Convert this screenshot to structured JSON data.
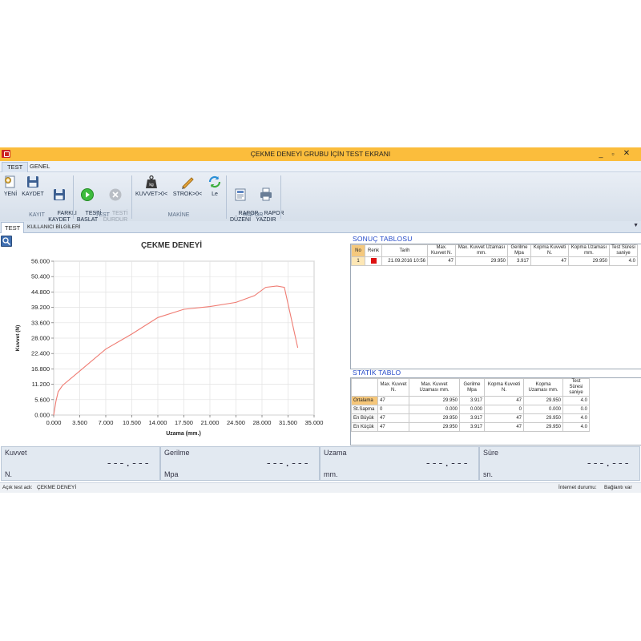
{
  "window": {
    "title": "ÇEKME DENEYİ GRUBU İÇİN TEST EKRANI",
    "controls": [
      "_",
      "▫",
      "✕"
    ]
  },
  "ribbon_tabs": [
    "TEST",
    "GENEL"
  ],
  "ribbon": {
    "groups": [
      {
        "label": "KAYIT",
        "buttons": [
          "YENİ",
          "KAYDET",
          "FARKLI\nKAYDET"
        ]
      },
      {
        "label": "TEST",
        "buttons": [
          "TESTİ\nBAŞLAT",
          "TESTİ\nDURDUR"
        ]
      },
      {
        "label": "MAKİNE",
        "buttons": [
          "KUVVET>0<",
          "STROK>0<",
          "Le"
        ]
      },
      {
        "label": "RAPOR",
        "buttons": [
          "RAPOR\nDÜZENİ",
          "RAPOR\nYAZDIR"
        ]
      }
    ],
    "icon_names": [
      "new-document-icon",
      "save-icon",
      "save-as-icon",
      "play-icon",
      "stop-icon",
      "weight-icon",
      "pencil-ruler-icon",
      "refresh-icon",
      "report-layout-icon",
      "printer-icon"
    ]
  },
  "subtabs": [
    "TEST",
    "KULLANICI BİLGİLERİ"
  ],
  "chart_data": {
    "type": "line",
    "title": "ÇEKME DENEYİ",
    "xlabel": "Uzama (mm.)",
    "ylabel": "Kuvvet (N)",
    "xlim": [
      0,
      35
    ],
    "ylim": [
      0,
      56
    ],
    "x_ticks": [
      "0.000",
      "3.500",
      "7.000",
      "10.500",
      "14.000",
      "17.500",
      "21.000",
      "24.500",
      "28.000",
      "31.500",
      "35.000"
    ],
    "y_ticks": [
      "0.000",
      "5.600",
      "11.200",
      "16.800",
      "22.400",
      "28.000",
      "33.600",
      "39.200",
      "44.800",
      "50.400",
      "56.000"
    ],
    "grid": true,
    "color": "#ef7b72",
    "series": [
      {
        "x": [
          0,
          0.3,
          0.6,
          1.2,
          3.5,
          7.0,
          10.5,
          14.0,
          17.5,
          21.0,
          24.5,
          27.0,
          28.5,
          30.0,
          31.0,
          32.8
        ],
        "y": [
          0,
          5.0,
          8.5,
          10.8,
          16.0,
          24.0,
          29.5,
          35.5,
          38.5,
          39.5,
          41.0,
          43.5,
          46.5,
          47.0,
          46.5,
          24.5
        ]
      }
    ]
  },
  "result_table": {
    "title": "SONUÇ TABLOSU",
    "headers": [
      "No",
      "Renk",
      "Tarih",
      "Max. Kuvvet N.",
      "Max. Kuvvet Uzaması mm.",
      "Gerilme Mpa",
      "Kopma Kuvveti N.",
      "Kopma Uzaması mm.",
      "Test Süresi saniye"
    ],
    "rows": [
      {
        "no": "1",
        "color": "#dd1111",
        "tarih": "21.09.2016 10:56",
        "max_kuvvet": "47",
        "max_uzama": "29.950",
        "gerilme": "3.917",
        "kopma_kuvvet": "47",
        "kopma_uzama": "29.950",
        "sure": "4.0"
      }
    ]
  },
  "stat_table": {
    "title": "STATİK TABLO",
    "headers": [
      "",
      "Max. Kuvvet N.",
      "Max. Kuvvet Uzaması mm.",
      "Gerilme Mpa",
      "Kopma Kuvveti N.",
      "Kopma Uzaması mm.",
      "Test Süresi saniye"
    ],
    "rows": [
      [
        "Ortalama",
        "47",
        "29.950",
        "3.917",
        "47",
        "29.950",
        "4.0"
      ],
      [
        "St.Sapma",
        "0",
        "0.000",
        "0.000",
        "0",
        "0.000",
        "0.0"
      ],
      [
        "En Büyük",
        "47",
        "29.950",
        "3.917",
        "47",
        "29.950",
        "4.0"
      ],
      [
        "En Küçük",
        "47",
        "29.950",
        "3.917",
        "47",
        "29.950",
        "4.0"
      ]
    ]
  },
  "readouts": [
    {
      "label": "Kuvvet",
      "value": "---.---",
      "unit": "N."
    },
    {
      "label": "Gerilme",
      "value": "---.---",
      "unit": "Mpa"
    },
    {
      "label": "Uzama",
      "value": "---.---",
      "unit": "mm."
    },
    {
      "label": "Süre",
      "value": "---.---",
      "unit": "sn."
    }
  ],
  "status": {
    "test_label": "Açık test adı:",
    "test_name": "ÇEKME DENEYİ",
    "conn_label": "İnternet durumu:",
    "conn_value": "Bağlantı var"
  }
}
